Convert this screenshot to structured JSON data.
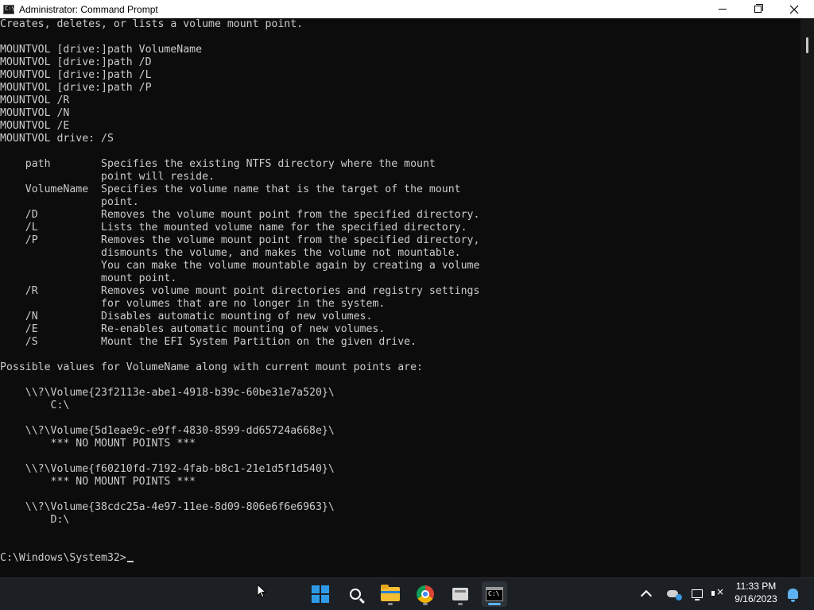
{
  "window": {
    "title": "Administrator: Command Prompt",
    "icon": "cmd-icon",
    "app_icon_glyph": "C:\\"
  },
  "console": {
    "lines": [
      "Creates, deletes, or lists a volume mount point.",
      "",
      "MOUNTVOL [drive:]path VolumeName",
      "MOUNTVOL [drive:]path /D",
      "MOUNTVOL [drive:]path /L",
      "MOUNTVOL [drive:]path /P",
      "MOUNTVOL /R",
      "MOUNTVOL /N",
      "MOUNTVOL /E",
      "MOUNTVOL drive: /S",
      "",
      "    path        Specifies the existing NTFS directory where the mount",
      "                point will reside.",
      "    VolumeName  Specifies the volume name that is the target of the mount",
      "                point.",
      "    /D          Removes the volume mount point from the specified directory.",
      "    /L          Lists the mounted volume name for the specified directory.",
      "    /P          Removes the volume mount point from the specified directory,",
      "                dismounts the volume, and makes the volume not mountable.",
      "                You can make the volume mountable again by creating a volume",
      "                mount point.",
      "    /R          Removes volume mount point directories and registry settings",
      "                for volumes that are no longer in the system.",
      "    /N          Disables automatic mounting of new volumes.",
      "    /E          Re-enables automatic mounting of new volumes.",
      "    /S          Mount the EFI System Partition on the given drive.",
      "",
      "Possible values for VolumeName along with current mount points are:",
      "",
      "    \\\\?\\Volume{23f2113e-abe1-4918-b39c-60be31e7a520}\\",
      "        C:\\",
      "",
      "    \\\\?\\Volume{5d1eae9c-e9ff-4830-8599-dd65724a668e}\\",
      "        *** NO MOUNT POINTS ***",
      "",
      "    \\\\?\\Volume{f60210fd-7192-4fab-b8c1-21e1d5f1d540}\\",
      "        *** NO MOUNT POINTS ***",
      "",
      "    \\\\?\\Volume{38cdc25a-4e97-11ee-8d09-806e6f6e6963}\\",
      "        D:\\",
      "",
      ""
    ],
    "prompt": "C:\\Windows\\System32>"
  },
  "taskbar": {
    "apps": [
      {
        "name": "start",
        "icon": "windows-start-icon"
      },
      {
        "name": "search",
        "icon": "search-icon"
      },
      {
        "name": "file-explorer",
        "icon": "folder-icon"
      },
      {
        "name": "chrome",
        "icon": "chrome-icon"
      },
      {
        "name": "app",
        "icon": "app-box-icon"
      },
      {
        "name": "command-prompt",
        "icon": "cmd-icon",
        "active": true
      }
    ],
    "cmd_icon_glyph": "C:\\",
    "tray": {
      "time": "11:33 PM",
      "date": "9/16/2023",
      "icons": [
        "chevron-up-icon",
        "onedrive-icon",
        "network-icon",
        "speaker-muted-icon",
        "notification-bell-icon"
      ]
    }
  },
  "colors": {
    "console_bg": "#0c0c0c",
    "console_text": "#cccccc",
    "taskbar_bg": "#1c2024",
    "accent": "#5fb2f2"
  }
}
